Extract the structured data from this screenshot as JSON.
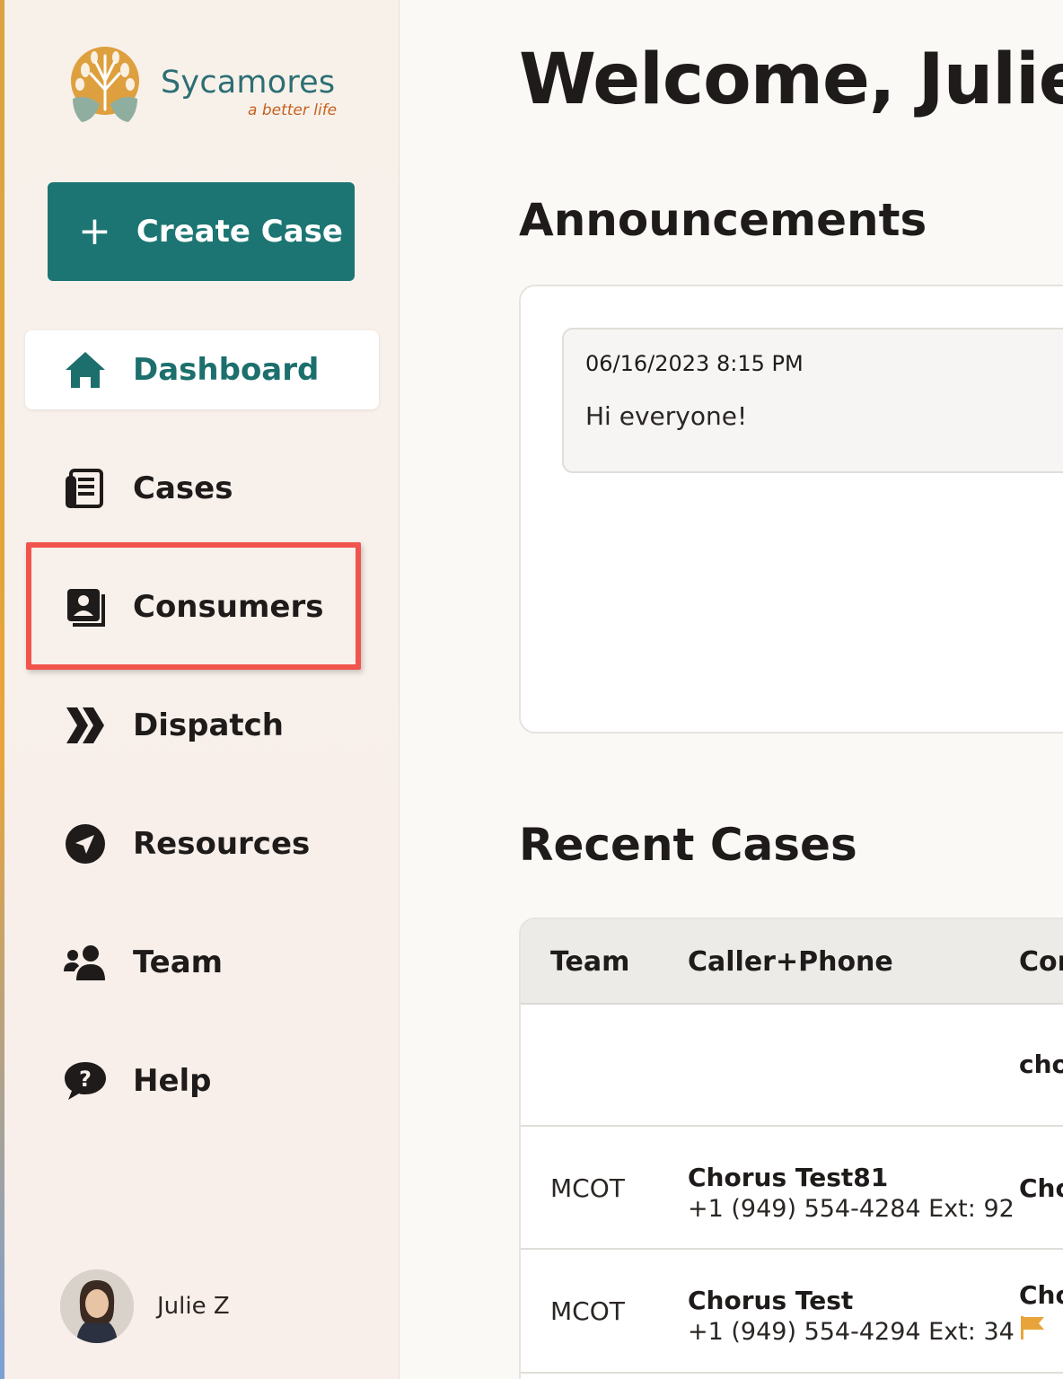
{
  "brand": {
    "name": "Sycamores",
    "tagline": "a better life"
  },
  "sidebar": {
    "create_button": {
      "plus": "+",
      "label": "Create Case"
    },
    "items": [
      {
        "label": "Dashboard",
        "icon": "home-icon",
        "active": true
      },
      {
        "label": "Cases",
        "icon": "document-icon"
      },
      {
        "label": "Consumers",
        "icon": "contact-book-icon",
        "highlighted": true
      },
      {
        "label": "Dispatch",
        "icon": "double-chevron-right-icon"
      },
      {
        "label": "Resources",
        "icon": "navigation-arrow-icon"
      },
      {
        "label": "Team",
        "icon": "users-icon"
      },
      {
        "label": "Help",
        "icon": "question-bubble-icon"
      }
    ],
    "user": {
      "name": "Julie Z"
    }
  },
  "main": {
    "welcome": "Welcome, Julie!",
    "announcements_title": "Announcements",
    "announcements": [
      {
        "date": "06/16/2023 8:15 PM",
        "message": "Hi everyone!"
      }
    ],
    "recent_cases_title": "Recent Cases",
    "table": {
      "columns": [
        "Team",
        "Caller+Phone",
        "Cor"
      ],
      "rows": [
        {
          "team": "",
          "caller_name": "",
          "caller_phone": "",
          "consumer": "cho"
        },
        {
          "team": "MCOT",
          "caller_name": "Chorus Test81",
          "caller_phone": "+1 (949) 554-4284 Ext: 92",
          "consumer": "Cho"
        },
        {
          "team": "MCOT",
          "caller_name": "Chorus Test",
          "caller_phone": "+1 (949) 554-4294 Ext: 34",
          "consumer": "Cho",
          "flag_icon": "flag-icon"
        }
      ]
    }
  },
  "colors": {
    "accent": "#1c7573",
    "highlight_border": "#f0544d",
    "flag": "#e8a43a"
  }
}
